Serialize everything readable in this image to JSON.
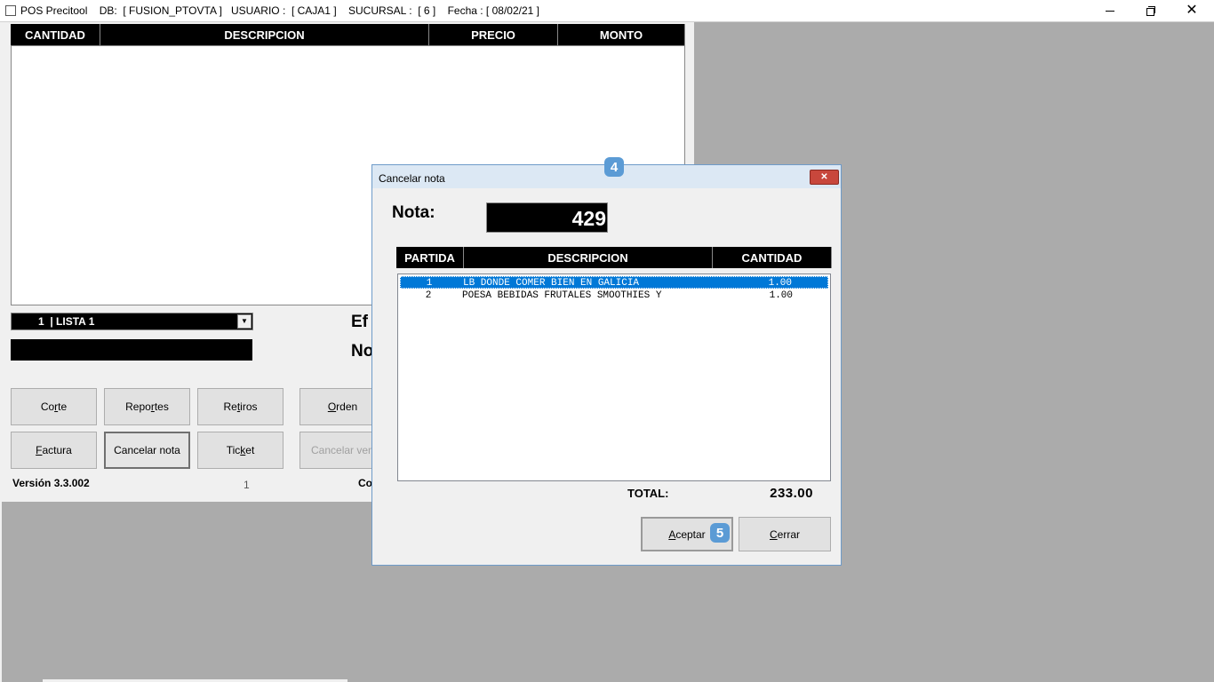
{
  "titlebar": {
    "title": "POS Precitool    DB:  [ FUSION_PTOVTA ]   USUARIO :  [ CAJA1 ]    SUCURSAL :  [ 6 ]    Fecha : [ 08/02/21 ]"
  },
  "main": {
    "columns": [
      "CANTIDAD",
      "DESCRIPCION",
      "PRECIO",
      "MONTO"
    ],
    "price_list": "1  | LISTA 1",
    "label_efectivo_partial": "Ef",
    "label_no_partial": "No",
    "buttons_row1": [
      {
        "label": "Corte",
        "mnemonic_pre": "Co",
        "mnemonic": "r",
        "mnemonic_post": "te"
      },
      {
        "label": "Reportes",
        "mnemonic_pre": "Repo",
        "mnemonic": "r",
        "mnemonic_post": "tes"
      },
      {
        "label": "Retiros",
        "mnemonic_pre": "Re",
        "mnemonic": "t",
        "mnemonic_post": "iros"
      },
      {
        "label": "Orden",
        "mnemonic_pre": "",
        "mnemonic": "O",
        "mnemonic_post": "rden"
      }
    ],
    "buttons_row2": [
      {
        "label": "Factura",
        "mnemonic_pre": "",
        "mnemonic": "F",
        "mnemonic_post": "actura"
      },
      {
        "label": "Cancelar nota",
        "mnemonic_pre": "",
        "mnemonic": "",
        "mnemonic_post": "Cancelar nota"
      },
      {
        "label": "Ticket",
        "mnemonic_pre": "Tic",
        "mnemonic": "k",
        "mnemonic_post": "et"
      },
      {
        "label": "Cancelar venta",
        "display": "Cancelar vent"
      }
    ],
    "version": "Versión 3.3.002",
    "page_number": "1",
    "footer_partial": "Co"
  },
  "dialog": {
    "title": "Cancelar nota",
    "nota_label": "Nota:",
    "nota_value": "429",
    "columns": [
      "PARTIDA",
      "DESCRIPCION",
      "CANTIDAD"
    ],
    "rows": [
      {
        "partida": "1",
        "descripcion": "LB DONDE COMER BIEN EN GALICIA",
        "cantidad": "1.00",
        "selected": true
      },
      {
        "partida": "2",
        "descripcion": "POESA BEBIDAS FRUTALES SMOOTHIES Y",
        "cantidad": "1.00",
        "selected": false
      }
    ],
    "total_label": "TOTAL:",
    "total_value": "233.00",
    "accept": {
      "pre": "",
      "mnemonic": "A",
      "post": "ceptar"
    },
    "close": {
      "pre": "",
      "mnemonic": "C",
      "post": "errar"
    }
  },
  "badges": {
    "step4": "4",
    "step5": "5"
  },
  "colors": {
    "selection": "#0078d7",
    "badge": "#5b9bd5",
    "close_button": "#c8473c",
    "dialog_title": "#dce8f4"
  },
  "icons": {
    "minimize": "minimize-icon",
    "restore": "restore-icon",
    "close": "close-icon",
    "dropdown": "chevron-down-icon"
  }
}
